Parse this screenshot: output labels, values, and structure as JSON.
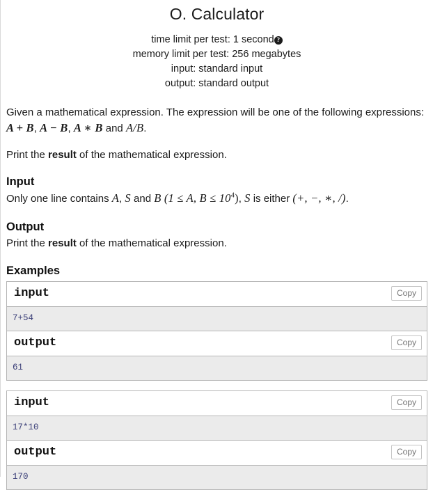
{
  "header": {
    "title": "O. Calculator",
    "limits": [
      {
        "label": "time limit per test:",
        "value": "1 second",
        "help": "?"
      },
      {
        "label": "memory limit per test:",
        "value": "256 megabytes"
      },
      {
        "label": "input:",
        "value": "standard input"
      },
      {
        "label": "output:",
        "value": "standard output"
      }
    ]
  },
  "legend": {
    "para1_before": "Given a mathematical expression. The expression will be one of the following expressions: ",
    "math_expr1": "A + B",
    "sep1": ", ",
    "math_expr2": "A − B",
    "sep2": ", ",
    "math_expr3": "A ∗ B",
    "and_text": " and ",
    "math_expr4": "A/B",
    "period": ".",
    "para2_before": "Print the ",
    "para2_bold": "result",
    "para2_after": " of the mathematical expression."
  },
  "input_spec": {
    "title": "Input",
    "text_before": "Only one line contains ",
    "math_A": "A",
    "comma1": ", ",
    "math_S": "S",
    "and_text": " and ",
    "math_B": "B",
    "constraint": "(1 ≤ A, B ≤ 10",
    "constraint_exp": "4",
    "constraint_end": ")",
    "comma2": ", ",
    "math_S2": "S",
    "text_after": " is either ",
    "operators": "(+, −, ∗, /)",
    "period": "."
  },
  "output_spec": {
    "title": "Output",
    "text_before": "Print the ",
    "bold": "result",
    "text_after": " of the mathematical expression."
  },
  "examples": {
    "title": "Examples",
    "copy_label": "Copy",
    "input_label": "input",
    "output_label": "output",
    "tests": [
      {
        "input": "7+54",
        "output": "61"
      },
      {
        "input": "17*10",
        "output": "170"
      }
    ]
  }
}
